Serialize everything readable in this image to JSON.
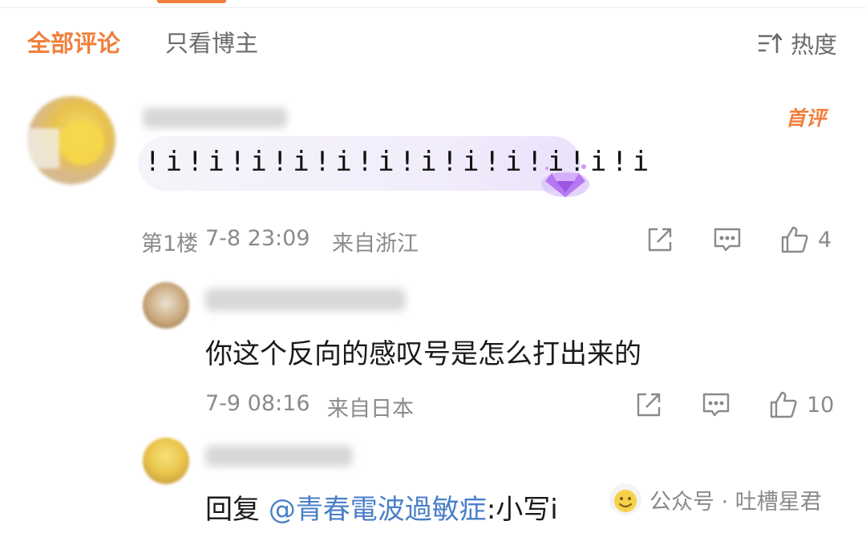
{
  "tabs": {
    "all_comments": "全部评论",
    "author_only": "只看博主"
  },
  "sort": {
    "label": "热度",
    "icon": "sort-lines-icon"
  },
  "colors": {
    "accent": "#f07f3c",
    "mention": "#4a7fc8",
    "meta": "#8a8a8a",
    "bubble_purple": "#b678f0"
  },
  "comments": [
    {
      "badge": "首评",
      "text": "!i!i!i!i!i!i!i!i!i!i!i!i",
      "floor": "第1楼",
      "time": "7-8 23:09",
      "location": "来自浙江",
      "likes": "4"
    },
    {
      "text": "你这个反向的感叹号是怎么打出来的",
      "time": "7-9 08:16",
      "location": "来自日本",
      "likes": "10"
    },
    {
      "reply_prefix": "回复 ",
      "mention": "@青春電波過敏症",
      "text": ":小写i"
    }
  ],
  "watermark": {
    "label": "公众号 · 吐槽星君"
  }
}
